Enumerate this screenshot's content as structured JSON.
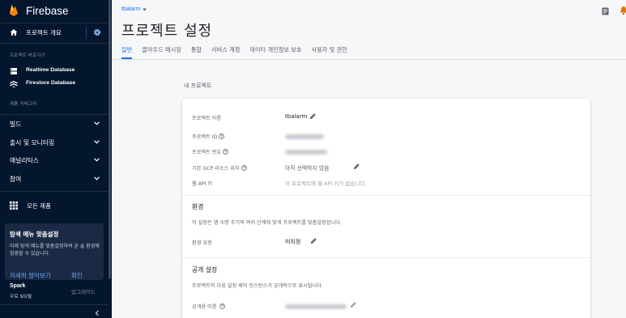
{
  "app": {
    "name": "Firebase"
  },
  "sidebar": {
    "overview_label": "프로젝트 개요",
    "shortcuts_title": "프로젝트 바로가기",
    "shortcuts": [
      {
        "label": "Realtime Database",
        "icon": "database-icon"
      },
      {
        "label": "Firestore Database",
        "icon": "firestore-icon"
      }
    ],
    "categories_title": "제품 카테고리",
    "categories": [
      {
        "label": "빌드"
      },
      {
        "label": "출시 및 모니터링"
      },
      {
        "label": "애널리틱스"
      },
      {
        "label": "참여"
      }
    ],
    "all_products": "모든 제품",
    "promo": {
      "title": "탐색 메뉴 맞춤설정",
      "body": "이제 탐색 메뉴를 맞춤설정하여 곧 솔 환경에 집중할 수 있습니다.",
      "learn_more": "자세히 알아보기",
      "confirm": "확인"
    },
    "plan": {
      "name": "Spark",
      "price": "무료 $0/월",
      "upgrade": "업그레이드"
    }
  },
  "header": {
    "project": "tbalarm",
    "title": "프로젝트 설정",
    "tabs": [
      "일반",
      "클라우드 메시징",
      "통합",
      "서비스 계정",
      "데이터 개인정보 보호",
      "사용자 및 권한"
    ],
    "active_tab": 0
  },
  "my_project": {
    "section_title": "내 프로젝트",
    "fields": {
      "name_label": "프로젝트 이름",
      "name_value": "tbalarm",
      "id_label": "프로젝트 ID",
      "number_label": "프로젝트 번호",
      "gcp_label": "기본 GCP 리소스 위치",
      "gcp_value": "아직 선택하지 않음",
      "apikey_label": "웹 API 키",
      "apikey_value": "이 프로젝트에 웹 API 키가 없습니다."
    },
    "environment": {
      "title": "환경",
      "desc": "이 설정은 앱 수명 주기의 여러 단계에 맞게 프로젝트를 맞춤설정합니다.",
      "type_label": "환경 유형",
      "type_value": "미지정"
    },
    "public": {
      "title": "공개 설정",
      "desc": "프로젝트의 다음 설정 제어 인스턴스가 공개적으로 표시됩니다.",
      "public_name_label": "공개용 이름"
    }
  },
  "colors": {
    "sidebar_bg": "#04152e",
    "accent": "#1a73e8",
    "flame": "#ffca28"
  }
}
